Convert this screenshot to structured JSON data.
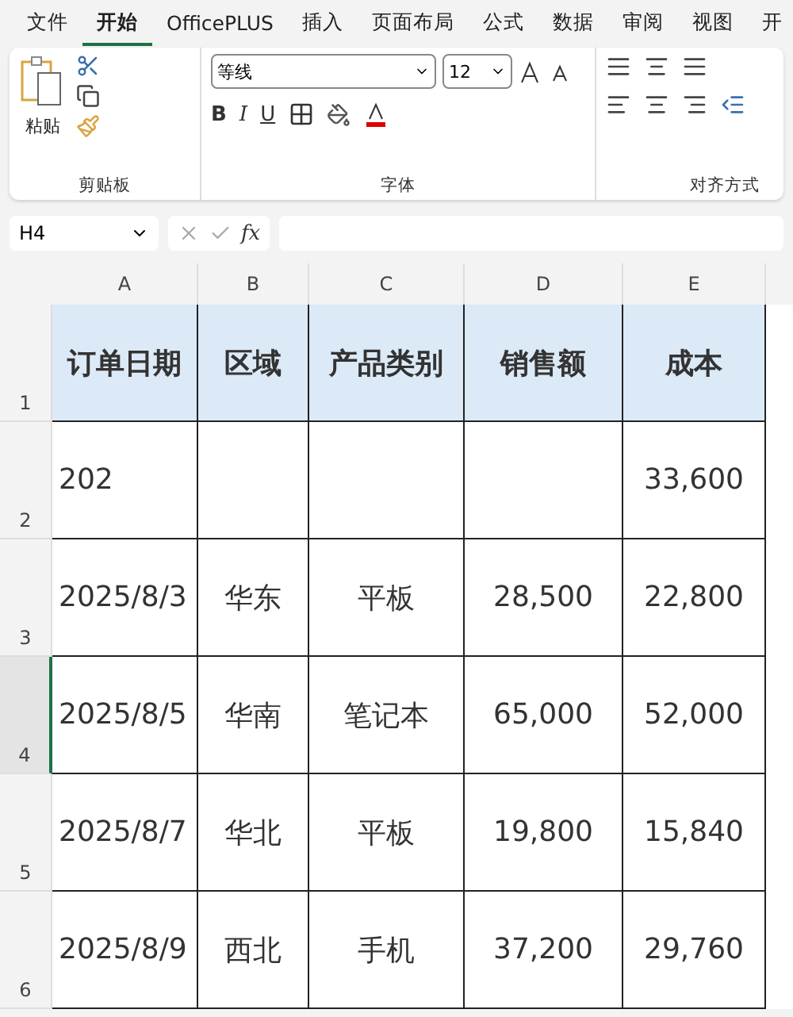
{
  "tabs": [
    {
      "label": "文件",
      "selected": false
    },
    {
      "label": "开始",
      "selected": true
    },
    {
      "label": "OfficePLUS",
      "selected": false
    },
    {
      "label": "插入",
      "selected": false
    },
    {
      "label": "页面布局",
      "selected": false
    },
    {
      "label": "公式",
      "selected": false
    },
    {
      "label": "数据",
      "selected": false
    },
    {
      "label": "审阅",
      "selected": false
    },
    {
      "label": "视图",
      "selected": false
    },
    {
      "label": "开",
      "selected": false
    }
  ],
  "ribbon": {
    "clipboard": {
      "paste": "粘贴",
      "label": "剪贴板"
    },
    "font": {
      "name": "等线",
      "size": "12",
      "bold": "B",
      "italic": "I",
      "underline": "U",
      "label": "字体"
    },
    "alignment": {
      "label": "对齐方式"
    }
  },
  "formula_bar": {
    "name_box": "H4",
    "fx": "fx"
  },
  "sheet": {
    "columns": [
      "A",
      "B",
      "C",
      "D",
      "E"
    ],
    "rows": [
      {
        "number": "1",
        "header": true,
        "selected": false,
        "cells": [
          "订单日期",
          "区域",
          "产品类别",
          "销售额",
          "成本"
        ]
      },
      {
        "number": "2",
        "header": false,
        "selected": false,
        "cells": [
          "202",
          "",
          "",
          "",
          "33,600"
        ]
      },
      {
        "number": "3",
        "header": false,
        "selected": false,
        "cells": [
          "2025/8/3",
          "华东",
          "平板",
          "28,500",
          "22,800"
        ]
      },
      {
        "number": "4",
        "header": false,
        "selected": true,
        "cells": [
          "2025/8/5",
          "华南",
          "笔记本",
          "65,000",
          "52,000"
        ]
      },
      {
        "number": "5",
        "header": false,
        "selected": false,
        "cells": [
          "2025/8/7",
          "华北",
          "平板",
          "19,800",
          "15,840"
        ]
      },
      {
        "number": "6",
        "header": false,
        "selected": false,
        "cells": [
          "2025/8/9",
          "西北",
          "手机",
          "37,200",
          "29,760"
        ]
      }
    ]
  }
}
